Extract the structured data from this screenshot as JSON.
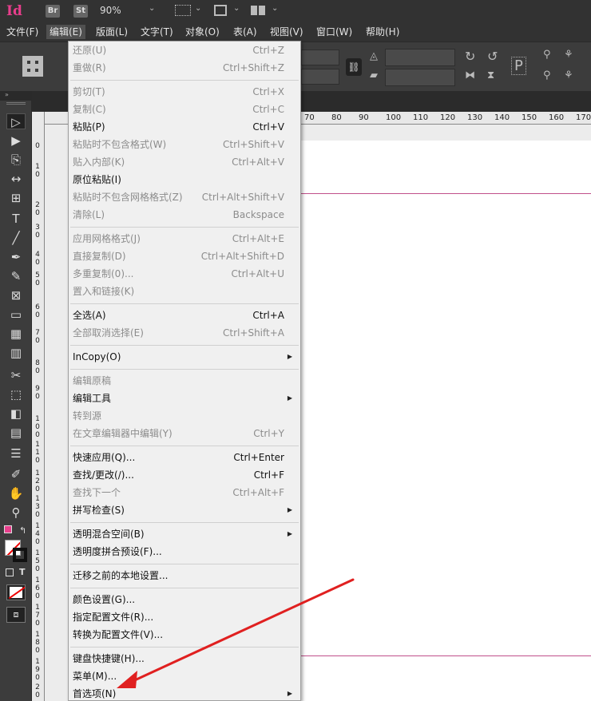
{
  "app": {
    "logo": "Id",
    "bridge_label": "Br",
    "stock_label": "St",
    "zoom": "90%"
  },
  "menubar": [
    {
      "label": "文件(F)"
    },
    {
      "label": "编辑(E)"
    },
    {
      "label": "版面(L)"
    },
    {
      "label": "文字(T)"
    },
    {
      "label": "对象(O)"
    },
    {
      "label": "表(A)"
    },
    {
      "label": "视图(V)"
    },
    {
      "label": "窗口(W)"
    },
    {
      "label": "帮助(H)"
    }
  ],
  "ruler": {
    "h_ticks": [
      "70",
      "80",
      "90",
      "100",
      "110",
      "120",
      "130",
      "140",
      "150",
      "160",
      "170"
    ],
    "v_ticks": [
      "0",
      "1 0",
      "2 0",
      "3 0",
      "4 0",
      "5 0",
      "6 0",
      "7 0",
      "8 0",
      "9 0",
      "1 0 0",
      "1 1 0",
      "1 2 0",
      "1 3 0",
      "1 4 0",
      "1 5 0",
      "1 6 0",
      "1 7 0",
      "1 8 0",
      "1 9 0",
      "2 0"
    ]
  },
  "edit_menu": {
    "items": [
      {
        "label": "还原(U)",
        "shortcut": "Ctrl+Z",
        "enabled": false
      },
      {
        "label": "重做(R)",
        "shortcut": "Ctrl+Shift+Z",
        "enabled": false
      },
      {
        "label": "剪切(T)",
        "shortcut": "Ctrl+X",
        "enabled": false
      },
      {
        "label": "复制(C)",
        "shortcut": "Ctrl+C",
        "enabled": false
      },
      {
        "label": "粘贴(P)",
        "shortcut": "Ctrl+V",
        "enabled": true
      },
      {
        "label": "粘贴时不包含格式(W)",
        "shortcut": "Ctrl+Shift+V",
        "enabled": false
      },
      {
        "label": "贴入内部(K)",
        "shortcut": "Ctrl+Alt+V",
        "enabled": false
      },
      {
        "label": "原位粘贴(I)",
        "shortcut": "",
        "enabled": true
      },
      {
        "label": "粘贴时不包含网格格式(Z)",
        "shortcut": "Ctrl+Alt+Shift+V",
        "enabled": false
      },
      {
        "label": "清除(L)",
        "shortcut": "Backspace",
        "enabled": false
      },
      {
        "label": "应用网格格式(J)",
        "shortcut": "Ctrl+Alt+E",
        "enabled": false
      },
      {
        "label": "直接复制(D)",
        "shortcut": "Ctrl+Alt+Shift+D",
        "enabled": false
      },
      {
        "label": "多重复制(0)...",
        "shortcut": "Ctrl+Alt+U",
        "enabled": false
      },
      {
        "label": "置入和链接(K)",
        "shortcut": "",
        "enabled": false
      },
      {
        "label": "全选(A)",
        "shortcut": "Ctrl+A",
        "enabled": true
      },
      {
        "label": "全部取消选择(E)",
        "shortcut": "Ctrl+Shift+A",
        "enabled": false
      },
      {
        "label": "InCopy(O)",
        "shortcut": "",
        "enabled": true,
        "submenu": true
      },
      {
        "label": "编辑原稿",
        "shortcut": "",
        "enabled": false
      },
      {
        "label": "编辑工具",
        "shortcut": "",
        "enabled": true,
        "submenu": true
      },
      {
        "label": "转到源",
        "shortcut": "",
        "enabled": false
      },
      {
        "label": "在文章编辑器中编辑(Y)",
        "shortcut": "Ctrl+Y",
        "enabled": false
      },
      {
        "label": "快速应用(Q)...",
        "shortcut": "Ctrl+Enter",
        "enabled": true
      },
      {
        "label": "查找/更改(/)...",
        "shortcut": "Ctrl+F",
        "enabled": true
      },
      {
        "label": "查找下一个",
        "shortcut": "Ctrl+Alt+F",
        "enabled": false
      },
      {
        "label": "拼写检查(S)",
        "shortcut": "",
        "enabled": true,
        "submenu": true
      },
      {
        "label": "透明混合空间(B)",
        "shortcut": "",
        "enabled": true,
        "submenu": true
      },
      {
        "label": "透明度拼合预设(F)...",
        "shortcut": "",
        "enabled": true
      },
      {
        "label": "迁移之前的本地设置...",
        "shortcut": "",
        "enabled": true
      },
      {
        "label": "颜色设置(G)...",
        "shortcut": "",
        "enabled": true
      },
      {
        "label": "指定配置文件(R)...",
        "shortcut": "",
        "enabled": true
      },
      {
        "label": "转换为配置文件(V)...",
        "shortcut": "",
        "enabled": true
      },
      {
        "label": "键盘快捷键(H)...",
        "shortcut": "",
        "enabled": true
      },
      {
        "label": "菜单(M)...",
        "shortcut": "",
        "enabled": true
      },
      {
        "label": "首选项(N)",
        "shortcut": "",
        "enabled": true,
        "submenu": true
      }
    ]
  },
  "colors": {
    "accent": "#e83e8c",
    "annotation_arrow": "#e02020",
    "guide": "#c0508a"
  }
}
